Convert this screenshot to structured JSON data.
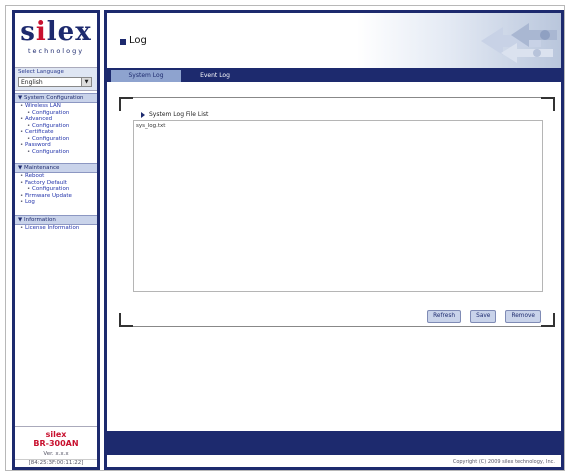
{
  "logo": {
    "word_pre": "s",
    "word_i": "i",
    "word_post": "lex",
    "tagline": "technology"
  },
  "language": {
    "label": "Select Language",
    "selected": "English"
  },
  "sidebar": {
    "sections": [
      {
        "title": "System Configuration",
        "items": [
          "Wireless LAN",
          "Configuration",
          "Advanced",
          "Configuration",
          "Certificate",
          "Configuration",
          "Password",
          "Configuration"
        ]
      },
      {
        "title": "Maintenance",
        "items": [
          "Reboot",
          "Factory Default",
          "Configuration",
          "Firmware Update",
          "Log"
        ]
      },
      {
        "title": "Information",
        "items": [
          "License Information"
        ]
      }
    ],
    "footer": {
      "brand": "silex",
      "model": "BR-300AN",
      "version": "Ver. x.x.x",
      "mac": "[84:25:3F:00:11:22]"
    }
  },
  "header": {
    "title": "Log"
  },
  "tabs": [
    {
      "label": "System Log"
    },
    {
      "label": "Event Log"
    }
  ],
  "panel": {
    "title": "System Log File List",
    "log_entry": "sys_log.txt",
    "buttons": {
      "refresh": "Refresh",
      "save": "Save",
      "remove": "Remove"
    }
  },
  "footer": {
    "copyright": "Copyright (C) 2009 silex technology, Inc."
  },
  "colors": {
    "brand_navy": "#1d2a6e",
    "brand_red": "#c8102e",
    "tab_active": "#8ea3cf"
  }
}
